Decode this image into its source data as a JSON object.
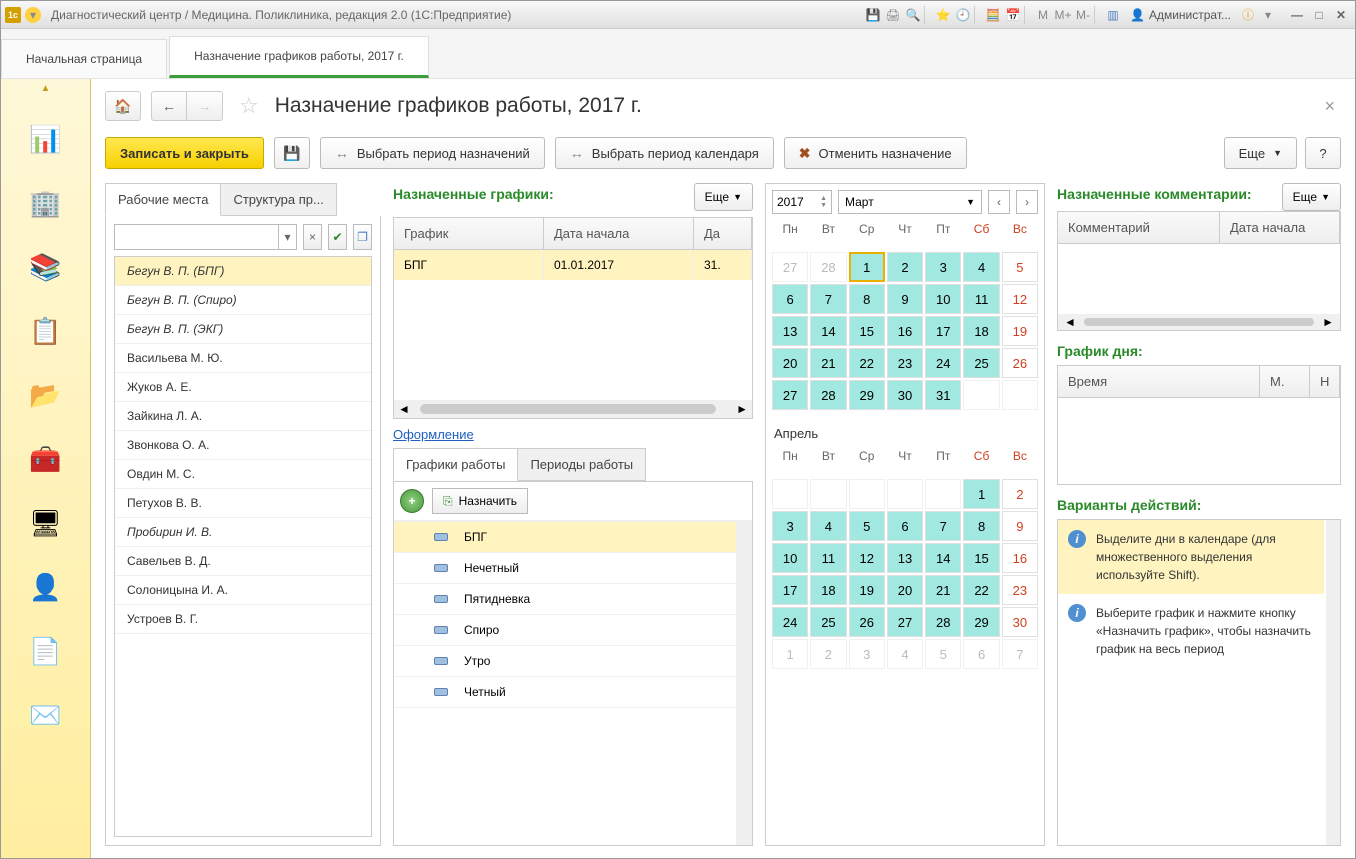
{
  "titlebar": {
    "title": "Диагностический центр / Медицина. Поликлиника, редакция 2.0  (1С:Предприятие)",
    "user": "Администрат...",
    "m": "M",
    "m_plus": "M+",
    "m_minus": "M-"
  },
  "page_tabs": {
    "start": "Начальная страница",
    "active": "Назначение графиков работы, 2017 г."
  },
  "page_title": "Назначение графиков работы, 2017 г.",
  "toolbar": {
    "save_close": "Записать и закрыть",
    "period_assign": "Выбрать период назначений",
    "period_calendar": "Выбрать период календаря",
    "cancel_assign": "Отменить назначение",
    "more": "Еще",
    "help": "?"
  },
  "left_tabs": {
    "workplaces": "Рабочие места",
    "structure": "Структура пр..."
  },
  "workers": [
    {
      "name": "Бегун В. П. (БПГ)",
      "italic": true,
      "sel": true
    },
    {
      "name": "Бегун В. П. (Спиро)",
      "italic": true
    },
    {
      "name": "Бегун В. П. (ЭКГ)",
      "italic": true
    },
    {
      "name": "Васильева М. Ю."
    },
    {
      "name": "Жуков А. Е."
    },
    {
      "name": "Зайкина Л. А."
    },
    {
      "name": "Звонкова О. А."
    },
    {
      "name": "Овдин М. С."
    },
    {
      "name": "Петухов В. В."
    },
    {
      "name": "Пробирин И. В.",
      "italic": true
    },
    {
      "name": "Савельев В. Д."
    },
    {
      "name": "Солоницына И. А."
    },
    {
      "name": "Устроев В. Г."
    }
  ],
  "assigned": {
    "title": "Назначенные графики:",
    "more": "Еще",
    "col_graph": "График",
    "col_start": "Дата начала",
    "col_end": "Да",
    "row": {
      "graph": "БПГ",
      "start": "01.01.2017",
      "end": "31."
    }
  },
  "design_link": "Оформление",
  "sched_tabs": {
    "work": "Графики работы",
    "periods": "Периоды работы"
  },
  "sched_toolbar": {
    "assign": "Назначить"
  },
  "schedules": [
    {
      "name": "БПГ",
      "sel": true
    },
    {
      "name": "Нечетный"
    },
    {
      "name": "Пятидневка"
    },
    {
      "name": "Спиро"
    },
    {
      "name": "Утро"
    },
    {
      "name": "Четный"
    }
  ],
  "calendar": {
    "year": "2017",
    "month1": "Март",
    "month2": "Апрель",
    "dh": [
      "Пн",
      "Вт",
      "Ср",
      "Чт",
      "Пт",
      "Сб",
      "Вс"
    ],
    "march": [
      {
        "d": "27",
        "cls": "other"
      },
      {
        "d": "28",
        "cls": "other"
      },
      {
        "d": "1",
        "cls": "work today"
      },
      {
        "d": "2",
        "cls": "work"
      },
      {
        "d": "3",
        "cls": "work"
      },
      {
        "d": "4",
        "cls": "work"
      },
      {
        "d": "5",
        "cls": "we-txt"
      },
      {
        "d": "6",
        "cls": "work"
      },
      {
        "d": "7",
        "cls": "work"
      },
      {
        "d": "8",
        "cls": "work"
      },
      {
        "d": "9",
        "cls": "work"
      },
      {
        "d": "10",
        "cls": "work"
      },
      {
        "d": "11",
        "cls": "work"
      },
      {
        "d": "12",
        "cls": "we-txt"
      },
      {
        "d": "13",
        "cls": "work"
      },
      {
        "d": "14",
        "cls": "work"
      },
      {
        "d": "15",
        "cls": "work"
      },
      {
        "d": "16",
        "cls": "work"
      },
      {
        "d": "17",
        "cls": "work"
      },
      {
        "d": "18",
        "cls": "work"
      },
      {
        "d": "19",
        "cls": "we-txt"
      },
      {
        "d": "20",
        "cls": "work"
      },
      {
        "d": "21",
        "cls": "work"
      },
      {
        "d": "22",
        "cls": "work"
      },
      {
        "d": "23",
        "cls": "work"
      },
      {
        "d": "24",
        "cls": "work"
      },
      {
        "d": "25",
        "cls": "work"
      },
      {
        "d": "26",
        "cls": "we-txt"
      },
      {
        "d": "27",
        "cls": "work"
      },
      {
        "d": "28",
        "cls": "work"
      },
      {
        "d": "29",
        "cls": "work"
      },
      {
        "d": "30",
        "cls": "work"
      },
      {
        "d": "31",
        "cls": "work"
      },
      {
        "d": "",
        "cls": "other"
      },
      {
        "d": "",
        "cls": "other"
      }
    ],
    "april": [
      {
        "d": "",
        "cls": "other"
      },
      {
        "d": "",
        "cls": "other"
      },
      {
        "d": "",
        "cls": "other"
      },
      {
        "d": "",
        "cls": "other"
      },
      {
        "d": "",
        "cls": "other"
      },
      {
        "d": "1",
        "cls": "work"
      },
      {
        "d": "2",
        "cls": "we-txt"
      },
      {
        "d": "3",
        "cls": "work"
      },
      {
        "d": "4",
        "cls": "work"
      },
      {
        "d": "5",
        "cls": "work"
      },
      {
        "d": "6",
        "cls": "work"
      },
      {
        "d": "7",
        "cls": "work"
      },
      {
        "d": "8",
        "cls": "work"
      },
      {
        "d": "9",
        "cls": "we-txt"
      },
      {
        "d": "10",
        "cls": "work"
      },
      {
        "d": "11",
        "cls": "work"
      },
      {
        "d": "12",
        "cls": "work"
      },
      {
        "d": "13",
        "cls": "work"
      },
      {
        "d": "14",
        "cls": "work"
      },
      {
        "d": "15",
        "cls": "work"
      },
      {
        "d": "16",
        "cls": "we-txt"
      },
      {
        "d": "17",
        "cls": "work"
      },
      {
        "d": "18",
        "cls": "work"
      },
      {
        "d": "19",
        "cls": "work"
      },
      {
        "d": "20",
        "cls": "work"
      },
      {
        "d": "21",
        "cls": "work"
      },
      {
        "d": "22",
        "cls": "work"
      },
      {
        "d": "23",
        "cls": "we-txt"
      },
      {
        "d": "24",
        "cls": "work"
      },
      {
        "d": "25",
        "cls": "work"
      },
      {
        "d": "26",
        "cls": "work"
      },
      {
        "d": "27",
        "cls": "work"
      },
      {
        "d": "28",
        "cls": "work"
      },
      {
        "d": "29",
        "cls": "work"
      },
      {
        "d": "30",
        "cls": "we-txt"
      },
      {
        "d": "1",
        "cls": "other"
      },
      {
        "d": "2",
        "cls": "other"
      },
      {
        "d": "3",
        "cls": "other"
      },
      {
        "d": "4",
        "cls": "other"
      },
      {
        "d": "5",
        "cls": "other"
      },
      {
        "d": "6",
        "cls": "other"
      },
      {
        "d": "7",
        "cls": "other"
      }
    ]
  },
  "comments": {
    "title": "Назначенные комментарии:",
    "more": "Еще",
    "col1": "Комментарий",
    "col2": "Дата начала"
  },
  "day": {
    "title": "График дня:",
    "col1": "Время",
    "col2": "М.",
    "col3": "Н"
  },
  "actions": {
    "title": "Варианты действий:",
    "tip1": "Выделите дни в календаре (для множественного выделения используйте Shift).",
    "tip2": "Выберите график и нажмите кнопку «Назначить график», чтобы назначить график на весь период"
  }
}
